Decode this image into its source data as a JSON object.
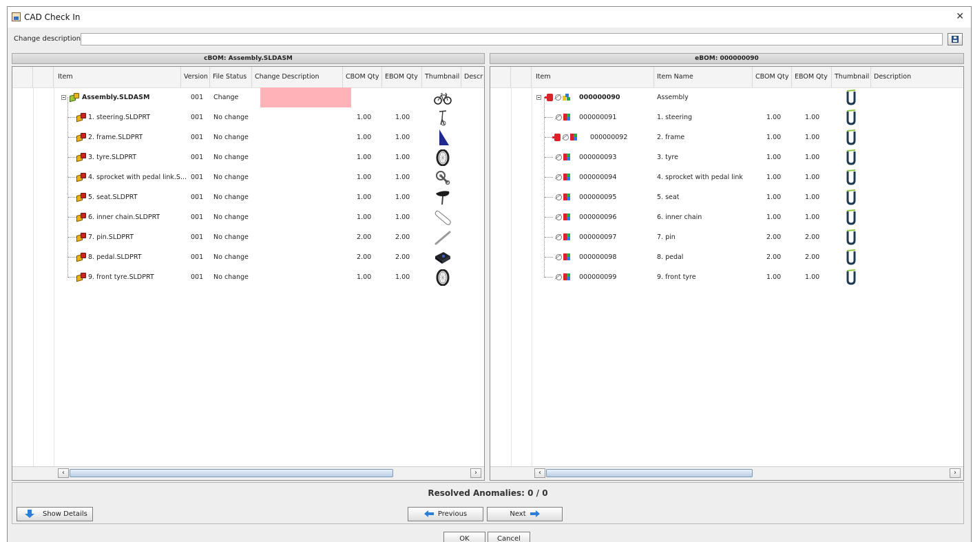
{
  "window": {
    "title": "CAD Check In"
  },
  "change_description": {
    "label": "Change description:",
    "value": ""
  },
  "cbom": {
    "title": "cBOM: Assembly.SLDASM",
    "columns": [
      "Item",
      "Version",
      "File Status",
      "Change Description",
      "CBOM Qty",
      "EBOM Qty",
      "Thumbnail",
      "Descr"
    ],
    "rows": [
      {
        "item": "Assembly.SLDASM",
        "version": "001",
        "status": "Change",
        "change_desc": "",
        "cbom_qty": "",
        "ebom_qty": "",
        "thumbnail": "bicycle-thumbnail"
      },
      {
        "item": "1. steering.SLDPRT",
        "version": "001",
        "status": "No change",
        "change_desc": "",
        "cbom_qty": "1.00",
        "ebom_qty": "1.00",
        "thumbnail": "steering-thumbnail"
      },
      {
        "item": "2. frame.SLDPRT",
        "version": "001",
        "status": "No change",
        "change_desc": "",
        "cbom_qty": "1.00",
        "ebom_qty": "1.00",
        "thumbnail": "frame-thumbnail"
      },
      {
        "item": "3. tyre.SLDPRT",
        "version": "001",
        "status": "No change",
        "change_desc": "",
        "cbom_qty": "1.00",
        "ebom_qty": "1.00",
        "thumbnail": "tyre-thumbnail"
      },
      {
        "item": "4. sprocket with pedal link.S...",
        "version": "001",
        "status": "No change",
        "change_desc": "",
        "cbom_qty": "1.00",
        "ebom_qty": "1.00",
        "thumbnail": "sprocket-thumbnail"
      },
      {
        "item": "5. seat.SLDPRT",
        "version": "001",
        "status": "No change",
        "change_desc": "",
        "cbom_qty": "1.00",
        "ebom_qty": "1.00",
        "thumbnail": "seat-thumbnail"
      },
      {
        "item": "6. inner chain.SLDPRT",
        "version": "001",
        "status": "No change",
        "change_desc": "",
        "cbom_qty": "1.00",
        "ebom_qty": "1.00",
        "thumbnail": "chain-thumbnail"
      },
      {
        "item": "7. pin.SLDPRT",
        "version": "001",
        "status": "No change",
        "change_desc": "",
        "cbom_qty": "2.00",
        "ebom_qty": "2.00",
        "thumbnail": "pin-thumbnail"
      },
      {
        "item": "8. pedal.SLDPRT",
        "version": "001",
        "status": "No change",
        "change_desc": "",
        "cbom_qty": "2.00",
        "ebom_qty": "2.00",
        "thumbnail": "pedal-thumbnail"
      },
      {
        "item": "9. front tyre.SLDPRT",
        "version": "001",
        "status": "No change",
        "change_desc": "",
        "cbom_qty": "1.00",
        "ebom_qty": "1.00",
        "thumbnail": "tyre-thumbnail"
      }
    ]
  },
  "ebom": {
    "title": "eBOM: 000000090",
    "columns": [
      "Item",
      "Item Name",
      "CBOM Qty",
      "EBOM Qty",
      "Thumbnail",
      "Description"
    ],
    "rows": [
      {
        "item": "000000090",
        "name": "Assembly",
        "cbom_qty": "",
        "ebom_qty": ""
      },
      {
        "item": "000000091",
        "name": "1. steering",
        "cbom_qty": "1.00",
        "ebom_qty": "1.00"
      },
      {
        "item": "000000092",
        "name": "2. frame",
        "cbom_qty": "1.00",
        "ebom_qty": "1.00"
      },
      {
        "item": "000000093",
        "name": "3. tyre",
        "cbom_qty": "1.00",
        "ebom_qty": "1.00"
      },
      {
        "item": "000000094",
        "name": "4. sprocket with pedal link",
        "cbom_qty": "1.00",
        "ebom_qty": "1.00"
      },
      {
        "item": "000000095",
        "name": "5. seat",
        "cbom_qty": "1.00",
        "ebom_qty": "1.00"
      },
      {
        "item": "000000096",
        "name": "6. inner chain",
        "cbom_qty": "1.00",
        "ebom_qty": "1.00"
      },
      {
        "item": "000000097",
        "name": "7. pin",
        "cbom_qty": "2.00",
        "ebom_qty": "2.00"
      },
      {
        "item": "000000098",
        "name": "8. pedal",
        "cbom_qty": "2.00",
        "ebom_qty": "2.00"
      },
      {
        "item": "000000099",
        "name": "9. front tyre",
        "cbom_qty": "1.00",
        "ebom_qty": "1.00"
      }
    ]
  },
  "anomalies": {
    "label": "Resolved Anomalies: 0 / 0"
  },
  "buttons": {
    "show_details": "Show Details",
    "previous": "Previous",
    "next": "Next",
    "ok": "OK",
    "cancel": "Cancel"
  },
  "colors": {
    "highlight": "#ffb3b8",
    "accent": "#2c7fd6"
  }
}
